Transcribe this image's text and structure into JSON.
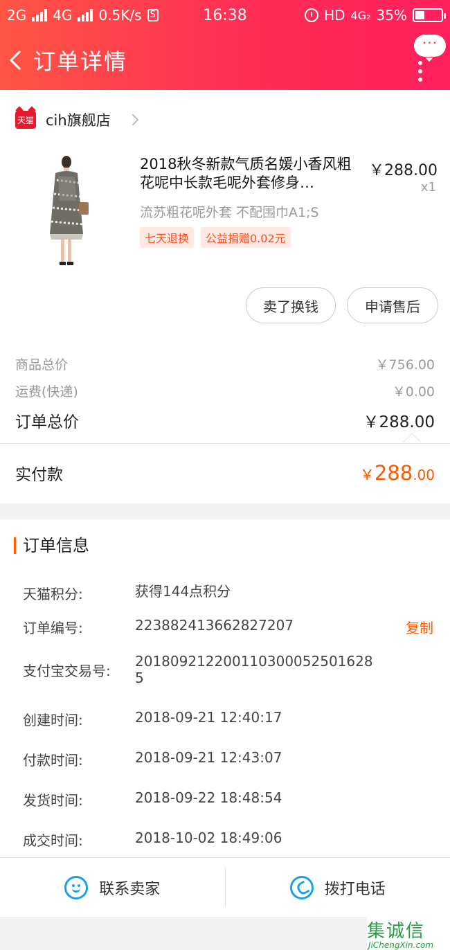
{
  "status_bar": {
    "sim1": "2G",
    "sim2": "4G",
    "speed": "0.5K/s",
    "s_icon": "S",
    "time": "16:38",
    "hd": "HD",
    "network": "4G₂",
    "battery": "35%",
    "battery_level": 0.35
  },
  "nav": {
    "back_icon": "chevron-left-icon",
    "title": "订单详情",
    "more_bubble": "···",
    "menu_icon": "vertical-dots-icon"
  },
  "shop": {
    "badge": "天猫",
    "name": "cih旗舰店"
  },
  "product": {
    "title": "2018秋冬新款气质名媛小香风粗花呢中长款毛呢外套修身…",
    "price": "￥288.00",
    "qty": "x1",
    "sku": "流苏粗花呢外套 不配围巾A1;S",
    "tags": [
      "七天退换",
      "公益捐赠0.02元"
    ]
  },
  "buttons": {
    "sell": "卖了换钱",
    "after_sale": "申请售后"
  },
  "summary": {
    "goods_label": "商品总价",
    "goods_value": "￥756.00",
    "shipping_label": "运费(快递)",
    "shipping_value": "￥0.00",
    "total_label": "订单总价",
    "total_value": "￥288.00",
    "paid_label": "实付款",
    "paid_symbol": "￥",
    "paid_int": "288",
    "paid_dec": ".00"
  },
  "order_info": {
    "title": "订单信息",
    "copy_label": "复制",
    "rows": [
      {
        "label": "天猫积分:",
        "value": "获得144点积分"
      },
      {
        "label": "订单编号:",
        "value": "223882413662827207"
      },
      {
        "label": "支付宝交易号:",
        "value": "2018092122001103000525016285"
      },
      {
        "label": "创建时间:",
        "value": "2018-09-21 12:40:17"
      },
      {
        "label": "付款时间:",
        "value": "2018-09-21 12:43:07"
      },
      {
        "label": "发货时间:",
        "value": "2018-09-22 18:48:54"
      },
      {
        "label": "成交时间:",
        "value": "2018-10-02 18:49:06"
      }
    ]
  },
  "actions": {
    "contact": "联系卖家",
    "call": "拨打电话"
  },
  "watermark": {
    "main": "集诚信",
    "sub": "JiChengXin.com"
  },
  "colors": {
    "header_gradient_start": "#ff5544",
    "header_gradient_end": "#ff1f5c",
    "accent_orange": "#ff5a00",
    "icon_blue": "#1ba0e5",
    "tmall_red": "#e8192c"
  }
}
